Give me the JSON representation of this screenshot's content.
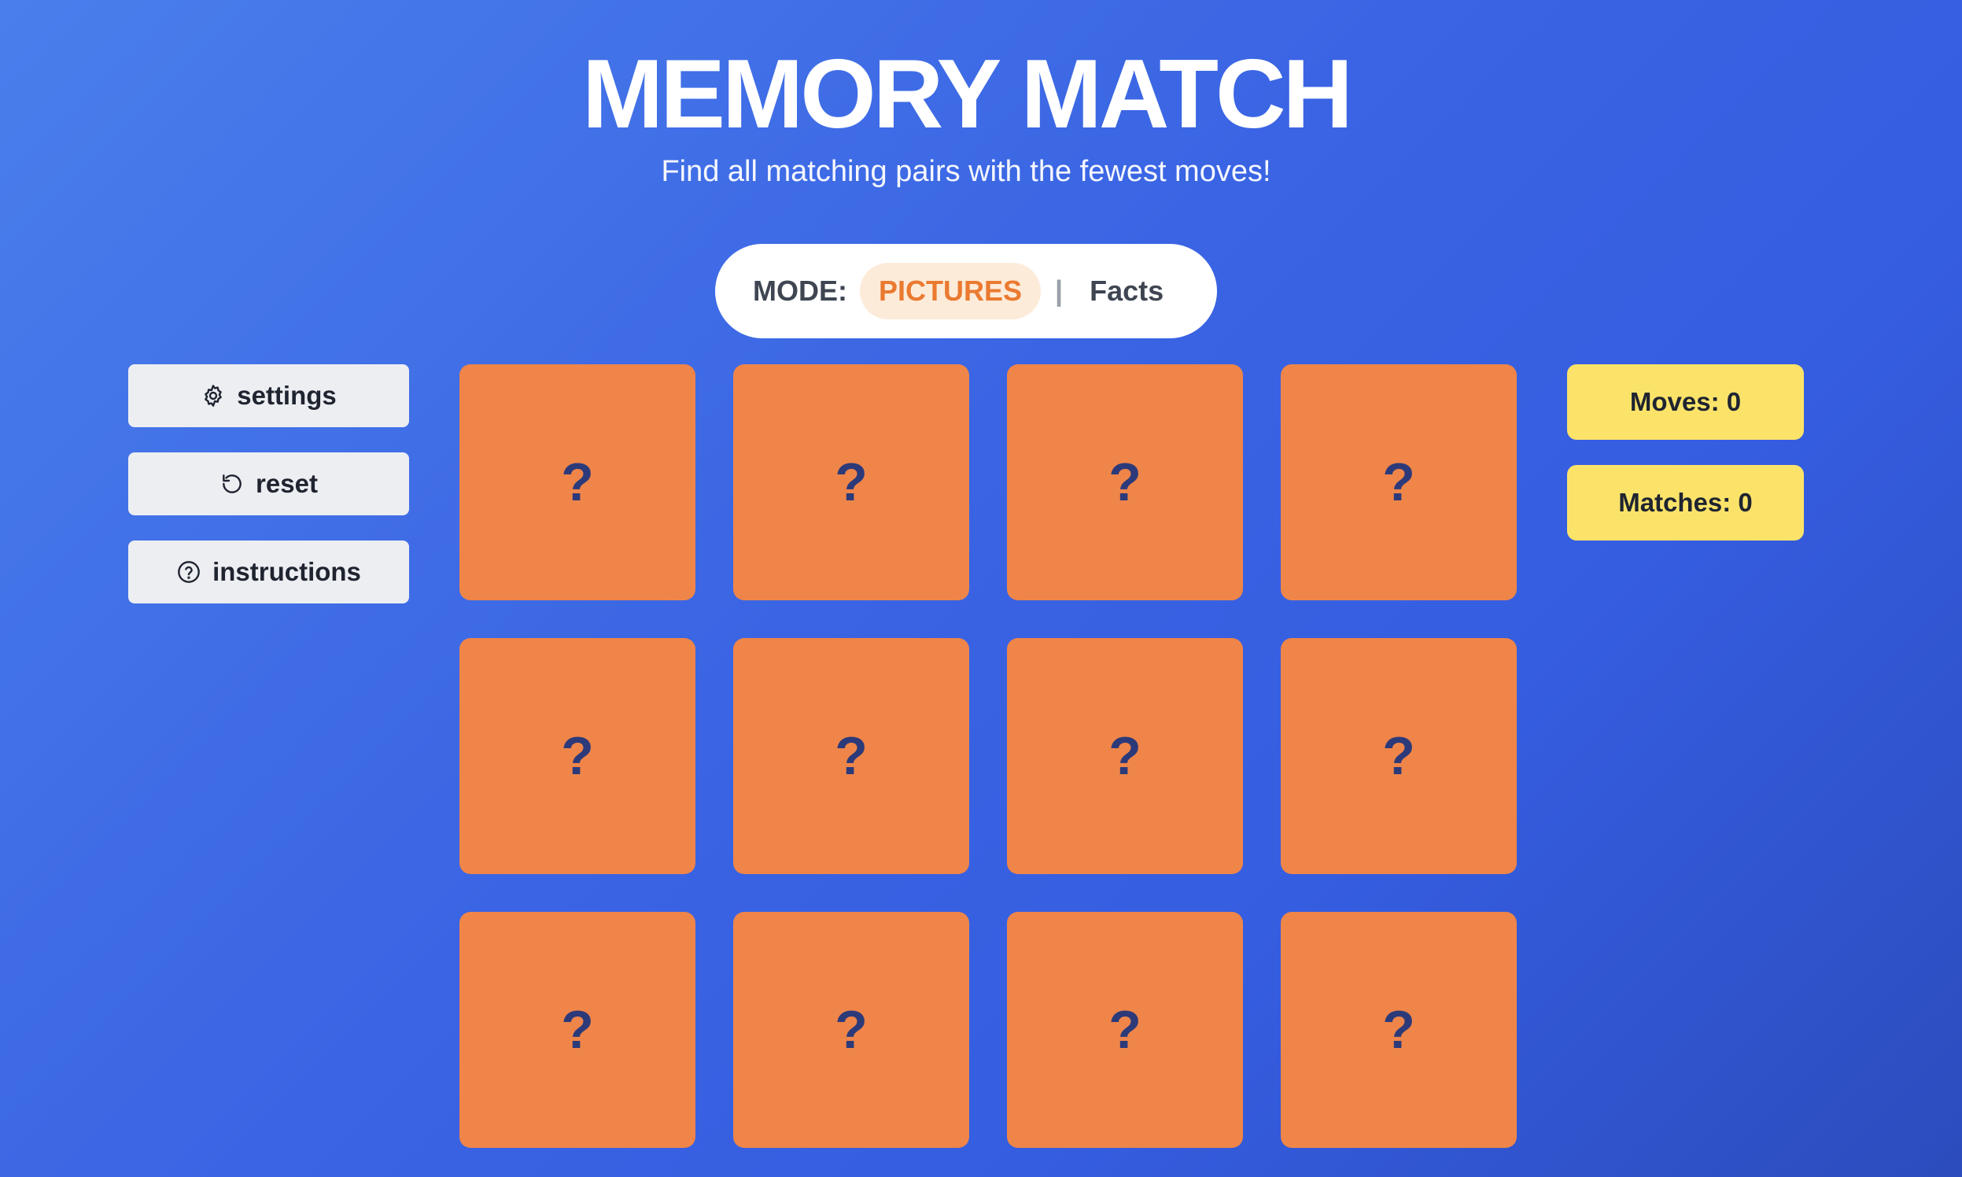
{
  "header": {
    "title": "MEMORY MATCH",
    "subtitle": "Find all matching pairs with the fewest moves!"
  },
  "mode": {
    "label": "MODE:",
    "options": [
      "PICTURES",
      "Facts"
    ],
    "selected": "PICTURES",
    "separator": "|"
  },
  "sidebar": {
    "buttons": [
      {
        "label": "settings",
        "icon": "gear-icon"
      },
      {
        "label": "reset",
        "icon": "reset-icon"
      },
      {
        "label": "instructions",
        "icon": "question-circle-icon"
      }
    ]
  },
  "board": {
    "rows": 3,
    "cols": 4,
    "cards": [
      "?",
      "?",
      "?",
      "?",
      "?",
      "?",
      "?",
      "?",
      "?",
      "?",
      "?",
      "?"
    ],
    "card_color": "#ef8549",
    "symbol_color": "#2c3a7a"
  },
  "stats": {
    "moves": "Moves: 0",
    "matches": "Matches: 0"
  },
  "colors": {
    "background": "#3a64e3",
    "accent": "#ea7a30",
    "stat_bg": "#fbe36a",
    "button_bg": "#eceef2"
  }
}
